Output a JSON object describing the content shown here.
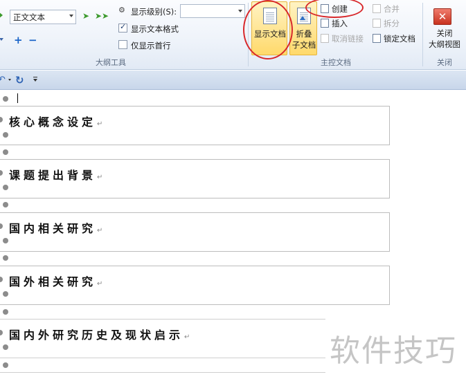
{
  "ribbon": {
    "outline_tools": {
      "style_select_value": "正文文本",
      "show_level_label": "显示级别(S):",
      "show_level_value": "",
      "show_text_format_label": "显示文本格式",
      "show_text_format_checked": true,
      "show_first_line_only_label": "仅显示首行",
      "show_first_line_only_checked": false,
      "group_label": "大纲工具"
    },
    "master_document": {
      "show_document_label": "显示文档",
      "collapse_line1": "折叠",
      "collapse_line2": "子文档",
      "create_label": "创建",
      "insert_label": "插入",
      "unlink_label": "取消链接",
      "merge_label": "合并",
      "split_label": "拆分",
      "lock_document_label": "锁定文档",
      "group_label": "主控文档"
    },
    "close": {
      "close_line1": "关闭",
      "close_line2": "大纲视图",
      "group_label": "关闭"
    }
  },
  "quick_access": {
    "undo_icon": "undo-icon",
    "redo_icon": "redo-icon",
    "customize_icon": "customize-quick-access-icon"
  },
  "document": {
    "headings": [
      "核心概念设定",
      "课题提出背景",
      "国内相关研究",
      "国外相关研究",
      "国内外研究历史及现状启示"
    ],
    "paragraph_mark": "↵"
  },
  "watermark": "软件技巧",
  "colors": {
    "highlight_button": "#ffd96b",
    "annotation_red": "#d8282b",
    "close_button": "#c8321f"
  }
}
